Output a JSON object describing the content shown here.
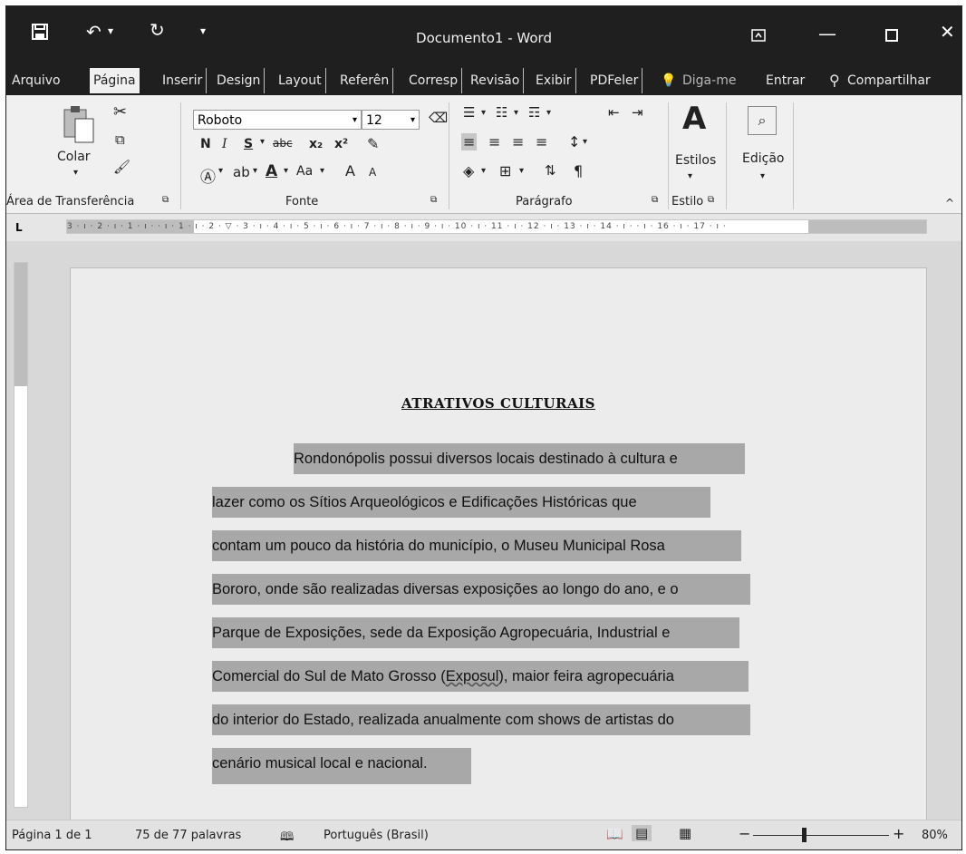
{
  "window": {
    "title": "Documento1 - Word",
    "icons": {
      "save": "save-icon",
      "undo": "undo-icon",
      "redo": "redo-icon",
      "customize": "customize-qat-icon",
      "ribbon_display": "ribbon-display-icon",
      "minimize": "minimize-icon",
      "maximize": "maximize-icon",
      "close": "close-icon"
    }
  },
  "tabs": [
    "Arquivo",
    "Página",
    "Inserir",
    "Design",
    "Layout",
    "Referên",
    "Corresp",
    "Revisão",
    "Exibir",
    "PDFeler"
  ],
  "tell_me": "Diga-me",
  "signin": "Entrar",
  "share": "Compartilhar",
  "ribbon": {
    "clipboard": {
      "paste": "Colar",
      "label": "Área de Transferência"
    },
    "font": {
      "name": "Roboto",
      "size": "12",
      "bold": "N",
      "italic": "I",
      "underline": "S",
      "strike": "abc",
      "subscript": "x₂",
      "superscript": "x²",
      "change_case": "Aa",
      "grow": "A",
      "shrink": "A",
      "label": "Fonte"
    },
    "paragraph": {
      "label": "Parágrafo",
      "pilcrow": "¶"
    },
    "styles": {
      "button": "Estilos",
      "label": "Estilo"
    },
    "editing": {
      "button": "Edição"
    }
  },
  "ruler_text": "3 · ı · 2 · ı · 1 · ı ·    · ı · 1 · ı · 2 · ▽ · 3 · ı · 4 · ı · 5 · ı · 6 · ı · 7 · ı · 8 · ı · 9 · ı · 10 · ı · 11 · ı · 12 · ı · 13 · ı · 14 · ı ·    · ı · 16 · ı · 17 · ı ·",
  "document": {
    "heading": "ATRATIVOS  CULTURAIS",
    "lines": [
      "Rondonópolis possui diversos locais destinado à cultura e",
      "lazer como os Sítios Arqueológicos e Edificações Históricas que",
      "contam um pouco da história do município, o Museu Municipal Rosa",
      "Bororo, onde são realizadas diversas exposições ao longo do ano, e o",
      "Parque de Exposições, sede da Exposição Agropecuária, Industrial e",
      "Comercial do Sul de Mato Grosso (",
      "Exposul",
      "), maior feira agropecuária",
      "do interior do Estado, realizada anualmente com shows de artistas do",
      "cenário musical local e nacional."
    ]
  },
  "status": {
    "page": "Página 1 de 1",
    "words": "75 de 77 palavras",
    "language": "Português (Brasil)",
    "zoom": "80%",
    "zoom_level": 0.8
  }
}
